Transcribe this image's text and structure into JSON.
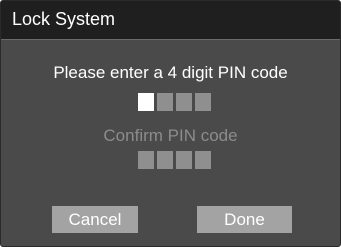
{
  "window": {
    "title": "Lock System"
  },
  "pin_entry": {
    "prompt": "Please enter a 4 digit PIN code",
    "digits": 4,
    "active_index": 0
  },
  "pin_confirm": {
    "prompt": "Confirm PIN code",
    "digits": 4
  },
  "buttons": {
    "cancel_label": "Cancel",
    "done_label": "Done"
  },
  "colors": {
    "titlebar": "#1f1f1f",
    "dialog_background": "#4a4a4a",
    "active_box": "#ffffff",
    "inactive_box": "#8f8f8f",
    "button": "#a3a3a3",
    "disabled_text": "#8c8c8c"
  }
}
